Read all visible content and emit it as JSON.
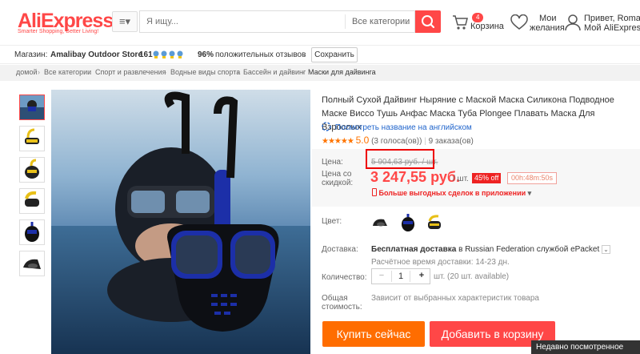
{
  "header": {
    "logo_text": "AliExpress",
    "logo_tagline": "Smarter Shopping, Better Living!",
    "menu_icon": "hamburger-icon",
    "search_placeholder": "Я ищу...",
    "category_select": "Все категории",
    "cart_count": "4",
    "cart_label": "Корзина",
    "wishlist_line1": "Мои",
    "wishlist_line2": "желания",
    "user_line1": "Привет, Roman",
    "user_line2": "Мой AliExpress"
  },
  "store_bar": {
    "store_label": "Магазин:",
    "store_name": "Amalibay Outdoor Store",
    "score": "161",
    "feedback_percent": "96%",
    "feedback_label": "положительных отзывов",
    "save_button": "Сохранить"
  },
  "breadcrumb": [
    "домой",
    "Все категории",
    "Спорт и развлечения",
    "Водные виды спорта",
    "Бассейн и дайвинг",
    "Маски для дайвинга"
  ],
  "product": {
    "title": "Полный Сухой Дайвинг Ныряние с Маской Маска Силикона Подводное Маске Виссо Тушь Анфас Маска Туба Plongee Плавать Маска Для Взрослых",
    "translate_link": "Посмотреть название на английском",
    "rating_value": "5.0",
    "rating_votes": "(3 голоса(ов))",
    "rating_stars": 5,
    "orders": "9 заказа(ов)",
    "price_label": "Цена:",
    "old_price": "5 904,63 руб. / шт.",
    "discount_label_line1": "Цена со",
    "discount_label_line2": "скидкой:",
    "new_price": "3 247,55 руб.",
    "unit": "/ шт.",
    "off_badge": "45% off",
    "timer": "00h:48m:50s",
    "app_deals": "Больше выгодных сделок в приложении",
    "color_label": "Цвет:",
    "shipping_label": "Доставка:",
    "shipping_free": "Бесплатная доставка",
    "shipping_in": "в",
    "shipping_country": "Russian Federation",
    "shipping_via": "службой ePacket",
    "shipping_estimate": "Расчётное время доставки: 14-23 дн.",
    "quantity_label": "Количество:",
    "quantity_value": "1",
    "quantity_minus": "−",
    "quantity_plus": "+",
    "quantity_available": "шт. (20 шт. available)",
    "total_label_line1": "Общая",
    "total_label_line2": "стоимость:",
    "total_text": "Зависит от выбранных характеристик товара",
    "buy_now": "Купить сейчас",
    "add_to_cart": "Добавить в корзину"
  },
  "recently_viewed": "Недавно посмотренное",
  "colors": {
    "brand_red": "#ff4747",
    "buy_orange": "#ff6d00",
    "mask_blue": "#1c2fa8"
  }
}
